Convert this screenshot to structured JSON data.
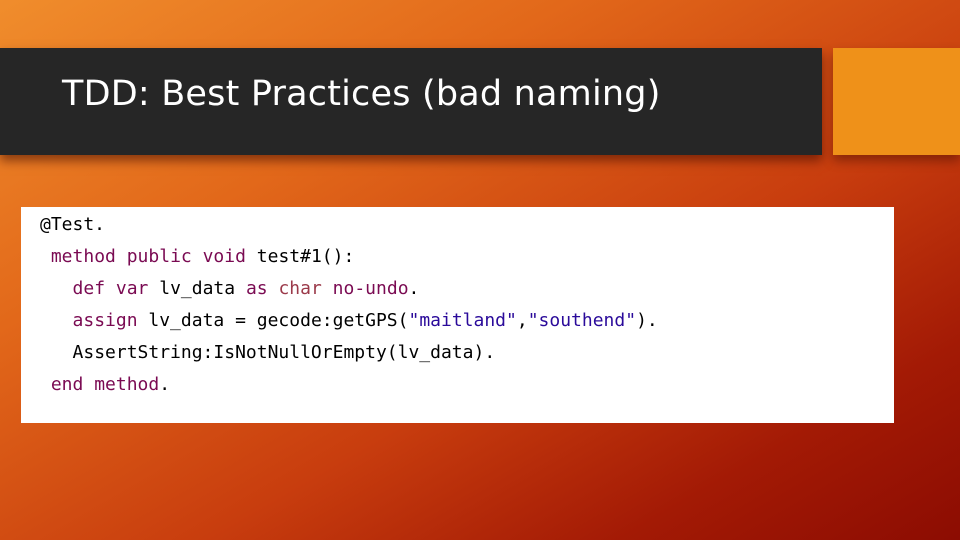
{
  "slide": {
    "title": "TDD: Best Practices (bad naming)",
    "colors": {
      "background_start": "#f08d2c",
      "background_end": "#8c0c02",
      "title_bar": "#262626",
      "accent_box": "#ef9119",
      "keyword": "#7a0a52",
      "type": "#9b3a4a",
      "string": "#2a0a9a"
    }
  },
  "code": {
    "lines": [
      {
        "indent": "",
        "tokens": [
          {
            "t": "@Test.",
            "c": "plain"
          }
        ]
      },
      {
        "indent": " ",
        "tokens": [
          {
            "t": "method",
            "c": "kw"
          },
          {
            "t": " ",
            "c": "plain"
          },
          {
            "t": "public",
            "c": "kw"
          },
          {
            "t": " ",
            "c": "plain"
          },
          {
            "t": "void",
            "c": "kw"
          },
          {
            "t": " test#1():",
            "c": "plain"
          }
        ]
      },
      {
        "indent": "   ",
        "tokens": [
          {
            "t": "def",
            "c": "kw"
          },
          {
            "t": " ",
            "c": "plain"
          },
          {
            "t": "var",
            "c": "kw"
          },
          {
            "t": " lv_data ",
            "c": "plain"
          },
          {
            "t": "as",
            "c": "kw"
          },
          {
            "t": " ",
            "c": "plain"
          },
          {
            "t": "char",
            "c": "ty"
          },
          {
            "t": " ",
            "c": "plain"
          },
          {
            "t": "no-undo",
            "c": "kw"
          },
          {
            "t": ".",
            "c": "plain"
          }
        ]
      },
      {
        "indent": "   ",
        "tokens": [
          {
            "t": "assign",
            "c": "kw"
          },
          {
            "t": " lv_data = gecode:getGPS(",
            "c": "plain"
          },
          {
            "t": "\"maitland\"",
            "c": "str"
          },
          {
            "t": ",",
            "c": "plain"
          },
          {
            "t": "\"southend\"",
            "c": "str"
          },
          {
            "t": ").",
            "c": "plain"
          }
        ]
      },
      {
        "indent": "   ",
        "tokens": [
          {
            "t": "AssertString:IsNotNullOrEmpty(lv_data).",
            "c": "plain"
          }
        ]
      },
      {
        "indent": " ",
        "tokens": [
          {
            "t": "end",
            "c": "kw"
          },
          {
            "t": " ",
            "c": "plain"
          },
          {
            "t": "method",
            "c": "kw"
          },
          {
            "t": ".",
            "c": "plain"
          }
        ]
      }
    ]
  }
}
